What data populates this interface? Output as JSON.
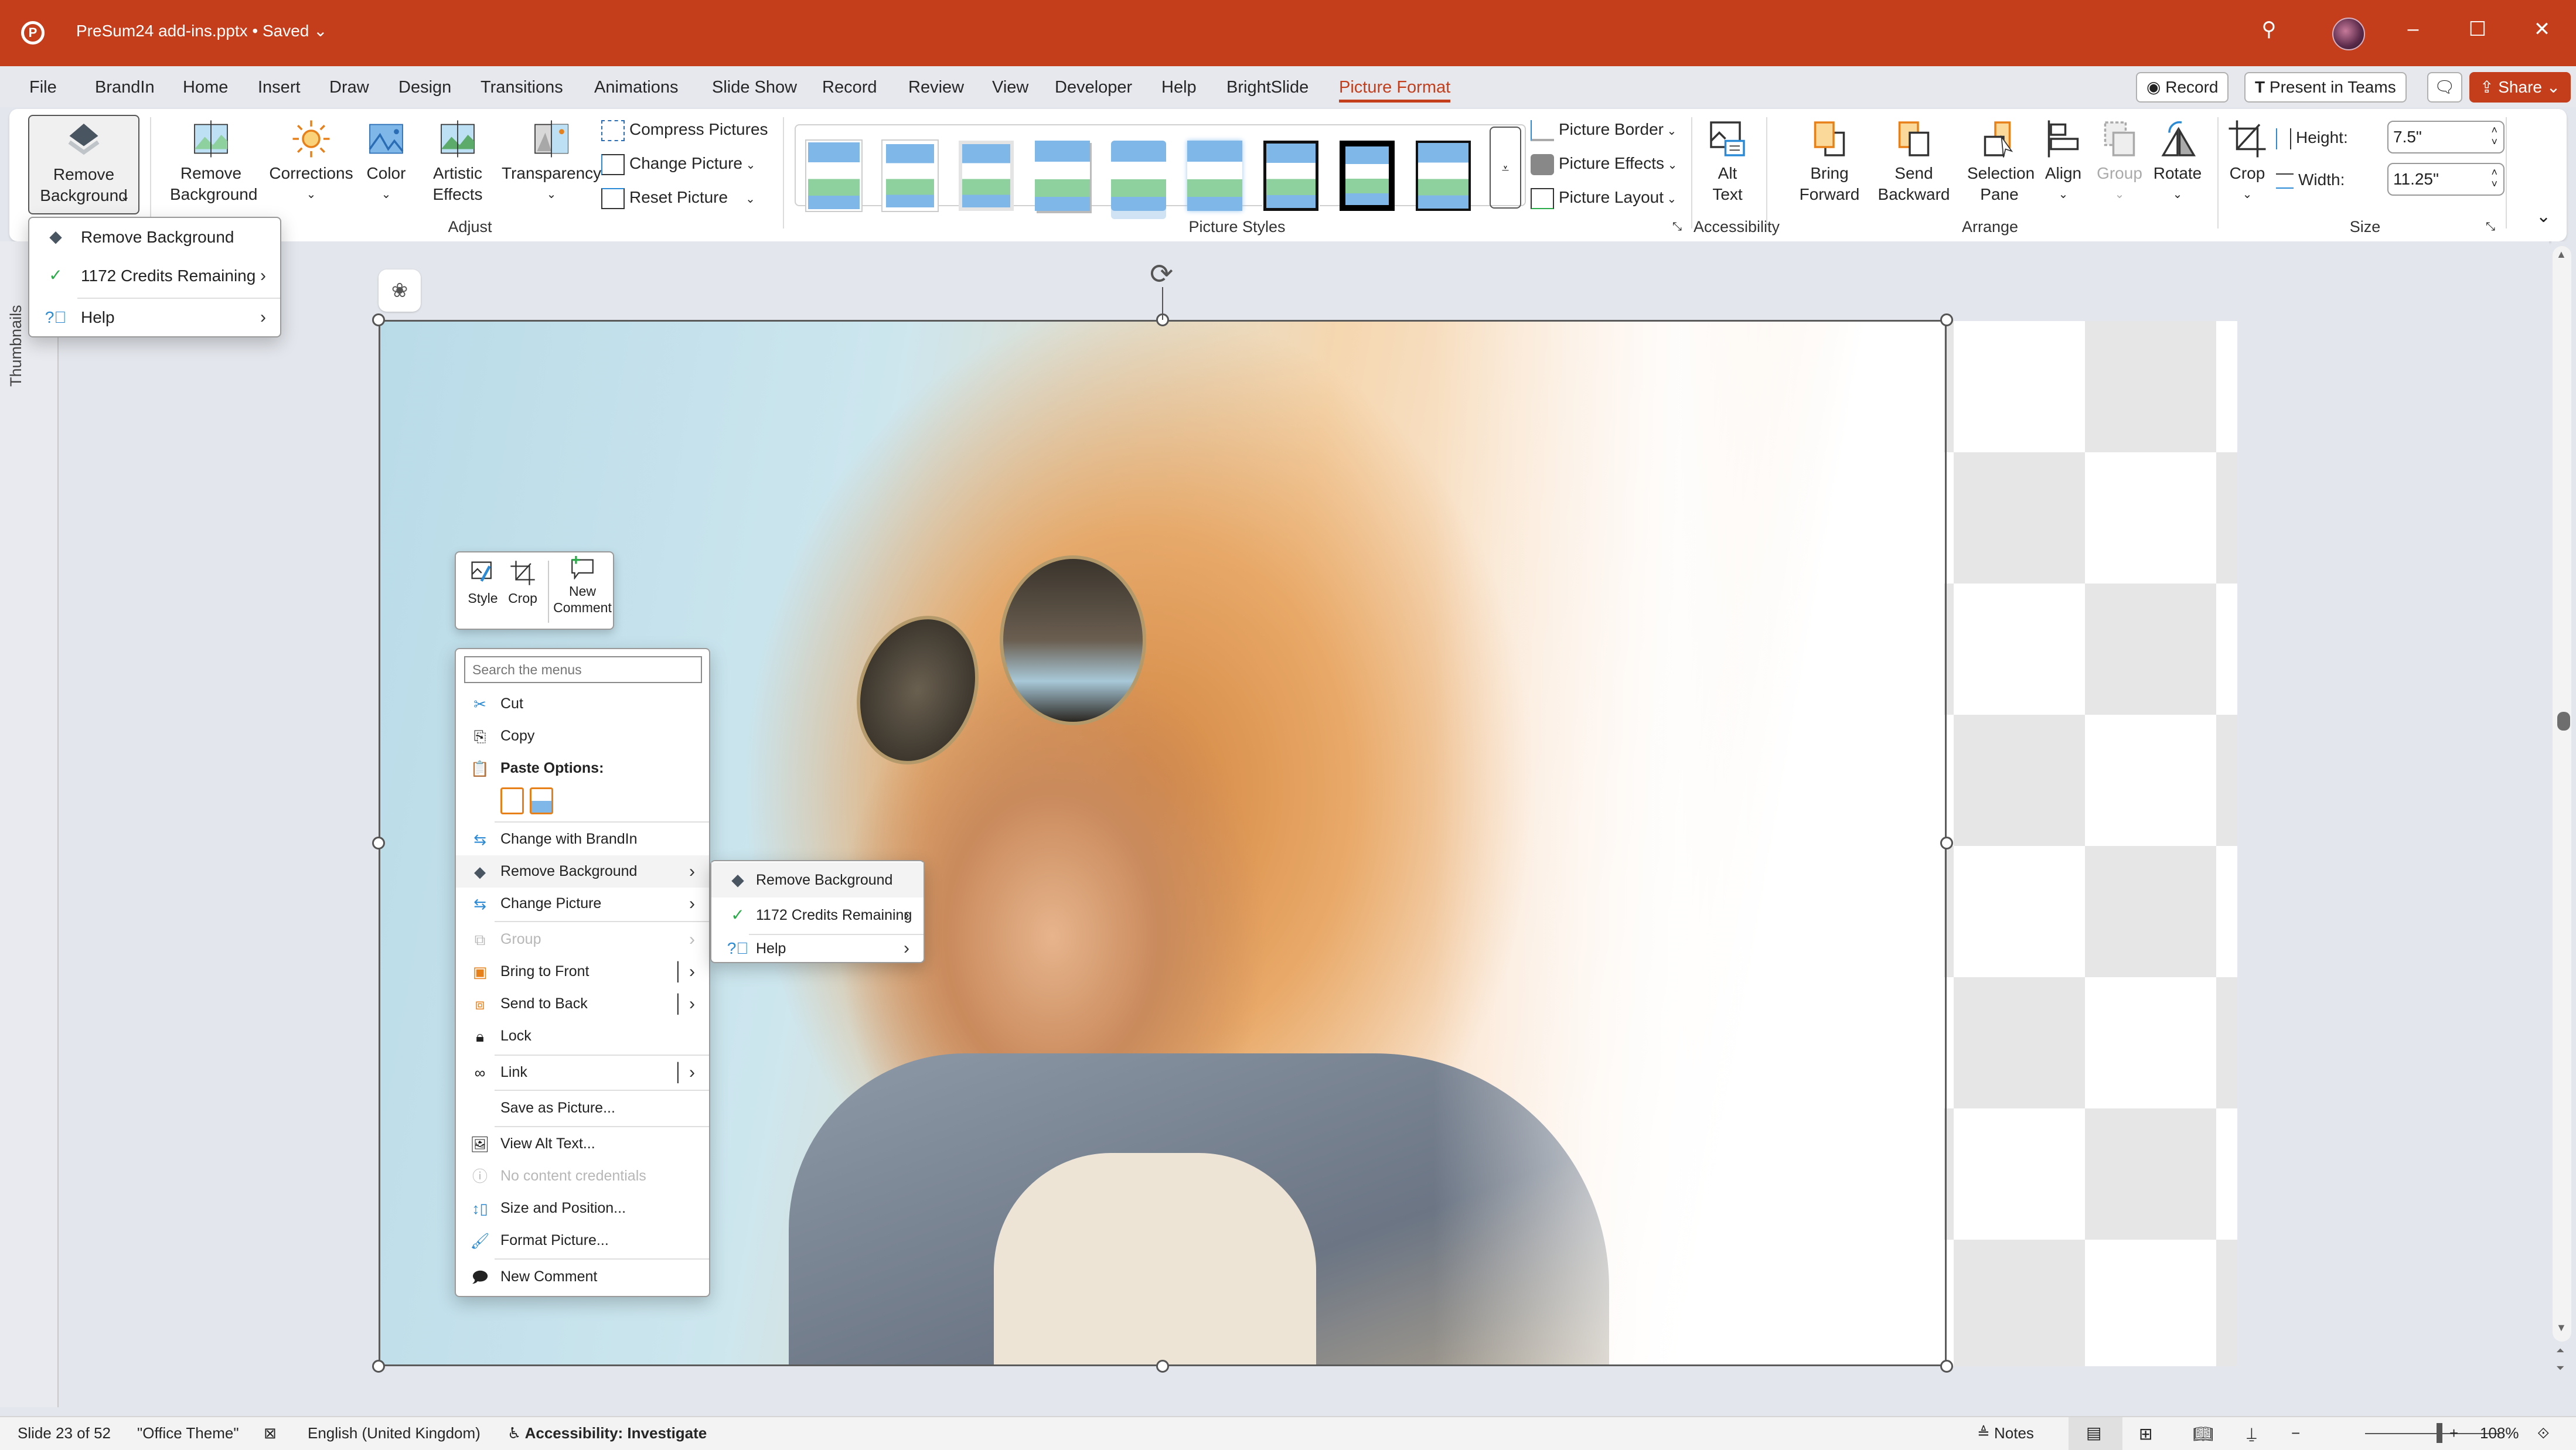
{
  "window": {
    "app_logo": "P",
    "title": "PreSum24 add-ins.pptx",
    "save_status": "Saved",
    "icons": {
      "search": "search-icon",
      "minimize": "minimize-icon",
      "maximize": "maximize-icon",
      "close": "close-icon"
    }
  },
  "tabs": [
    {
      "label": "File"
    },
    {
      "label": "BrandIn"
    },
    {
      "label": "Home"
    },
    {
      "label": "Insert"
    },
    {
      "label": "Draw"
    },
    {
      "label": "Design"
    },
    {
      "label": "Transitions"
    },
    {
      "label": "Animations"
    },
    {
      "label": "Slide Show"
    },
    {
      "label": "Record"
    },
    {
      "label": "Review"
    },
    {
      "label": "View"
    },
    {
      "label": "Developer"
    },
    {
      "label": "Help"
    },
    {
      "label": "BrightSlide"
    },
    {
      "label": "Picture Format",
      "active": true
    }
  ],
  "tab_actions": {
    "record": "Record",
    "present_teams": "Present in Teams",
    "share": "Share"
  },
  "ribbon": {
    "remove_bg_addin": "Remove Background",
    "remove_bg": "Remove Background",
    "corrections": "Corrections",
    "color": "Color",
    "artistic_effects": "Artistic Effects",
    "transparency": "Transparency",
    "compress_pictures": "Compress Pictures",
    "change_picture": "Change Picture",
    "reset_picture": "Reset Picture",
    "group_adjust": "Adjust",
    "picture_border": "Picture Border",
    "picture_effects": "Picture Effects",
    "picture_layout": "Picture Layout",
    "group_picture_styles": "Picture Styles",
    "alt_text": "Alt Text",
    "group_accessibility": "Accessibility",
    "bring_forward": "Bring Forward",
    "send_backward": "Send Backward",
    "selection_pane": "Selection Pane",
    "align": "Align",
    "group": "Group",
    "rotate": "Rotate",
    "group_arrange": "Arrange",
    "crop": "Crop",
    "height_label": "Height:",
    "height_value": "7.5\"",
    "width_label": "Width:",
    "width_value": "11.25\"",
    "group_size": "Size",
    "picture_styles_count": 9
  },
  "ribbon_dropdown": {
    "items": [
      {
        "label": "Remove Background",
        "icon": "layers-icon"
      },
      {
        "label": "1172 Credits Remaining",
        "icon": "check-icon",
        "submenu": true
      },
      {
        "label": "Help",
        "icon": "help-icon",
        "submenu": true
      }
    ]
  },
  "thumbnails_label": "Thumbnails",
  "mini_toolbar": {
    "style": "Style",
    "crop": "Crop",
    "new_comment_1": "New",
    "new_comment_2": "Comment"
  },
  "context_menu": {
    "search_placeholder": "Search the menus",
    "cut": "Cut",
    "copy": "Copy",
    "paste_options": "Paste Options:",
    "change_with_brandin": "Change with BrandIn",
    "remove_background": "Remove Background",
    "change_picture": "Change Picture",
    "group": "Group",
    "bring_to_front": "Bring to Front",
    "send_to_back": "Send to Back",
    "lock": "Lock",
    "link": "Link",
    "save_as_picture": "Save as Picture...",
    "view_alt_text": "View Alt Text...",
    "no_content_credentials": "No content credentials",
    "size_and_position": "Size and Position...",
    "format_picture": "Format Picture...",
    "new_comment": "New Comment"
  },
  "submenu": {
    "items": [
      {
        "label": "Remove Background"
      },
      {
        "label": "1172 Credits Remaining"
      },
      {
        "label": "Help"
      }
    ]
  },
  "statusbar": {
    "slide": "Slide 23 of 52",
    "theme": "\"Office Theme\"",
    "language": "English (United Kingdom)",
    "accessibility": "Accessibility: Investigate",
    "notes": "Notes",
    "zoom": "108%",
    "zoom_fraction": 0.55
  },
  "colors": {
    "accent": "#c43e1c",
    "ribbon_bg": "#ffffff",
    "canvas_bg": "#e3e6ec"
  }
}
